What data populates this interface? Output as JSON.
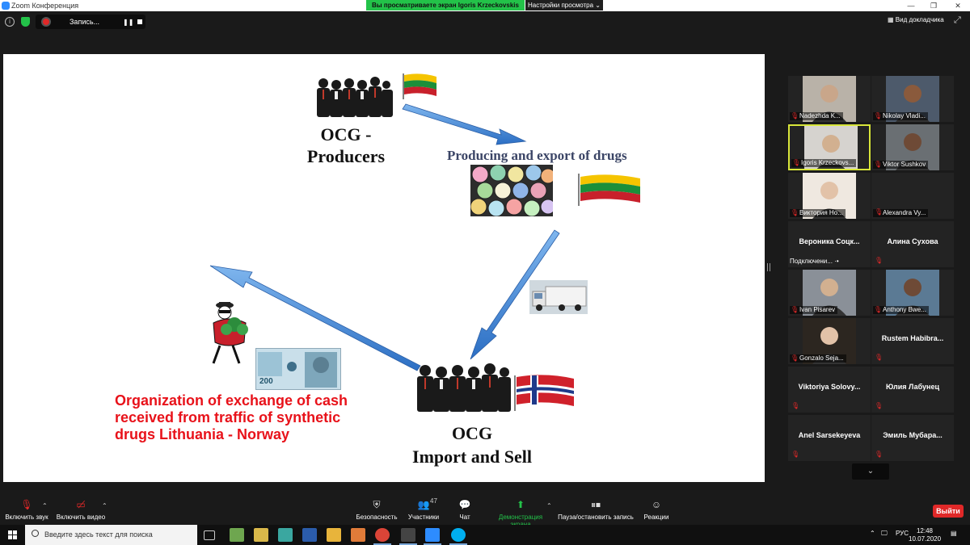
{
  "window": {
    "title": "Zoom Конференция",
    "share_banner": "Вы просматриваете экран Igoris Krzeckovskis",
    "view_options": "Настройки просмотра ⌄"
  },
  "topbar": {
    "recording_label": "Запись...",
    "document_view": "Вид докладчика"
  },
  "slide": {
    "ocg_producers_line1": "OCG -",
    "ocg_producers_line2": "Producers",
    "drugs_caption": "Producing and export of drugs",
    "ocg_import_line1": "OCG",
    "ocg_import_line2": "Import and Sell",
    "cash_line1": "Organization of exchange of cash",
    "cash_line2": "received from traffic of synthetic",
    "cash_line3": "drugs Lithuania - Norway",
    "banknote_value": "200",
    "colors": {
      "text_red": "#e8121a",
      "caption_blue": "#3b4566",
      "arrow_blue": "#3d86d6"
    }
  },
  "participants": [
    {
      "name": "Nadezhda K...",
      "video": true
    },
    {
      "name": "Nikolay Vladi...",
      "video": true
    },
    {
      "name": "Igoris Krzeckovs...",
      "video": true,
      "active": true
    },
    {
      "name": "Viktor Sushkov",
      "video": true
    },
    {
      "name": "Виктория Но...",
      "video": true
    },
    {
      "name": "Alexandra Vy...",
      "video": false
    },
    {
      "name": "Вероника  Соцк...",
      "video": false,
      "status": "Подключени..."
    },
    {
      "name": "Алина Сухова",
      "video": false
    },
    {
      "name": "Ivan Pisarev",
      "video": true
    },
    {
      "name": "Anthony Bwe...",
      "video": true
    },
    {
      "name": "Gonzalo Seja...",
      "video": true
    },
    {
      "name": "Rustem  Habibra...",
      "video": false
    },
    {
      "name": "Viktoriya  Solovy...",
      "video": false
    },
    {
      "name": "Юлия Лабунец",
      "video": false
    },
    {
      "name": "Anel Sarsekeyeva",
      "video": false
    },
    {
      "name": "Эмиль  Мубара...",
      "video": false
    }
  ],
  "toolbar": {
    "audio": "Включить звук",
    "video": "Включить видео",
    "security": "Безопасность",
    "participants": "Участники",
    "participants_count": "47",
    "chat": "Чат",
    "share": "Демонстрация экрана",
    "record": "Пауза/остановить запись",
    "reactions": "Реакции",
    "leave": "Выйти"
  },
  "taskbar": {
    "search_placeholder": "Введите здесь текст для поиска",
    "lang": "РУС",
    "time": "12:48",
    "date": "10.07.2020"
  }
}
